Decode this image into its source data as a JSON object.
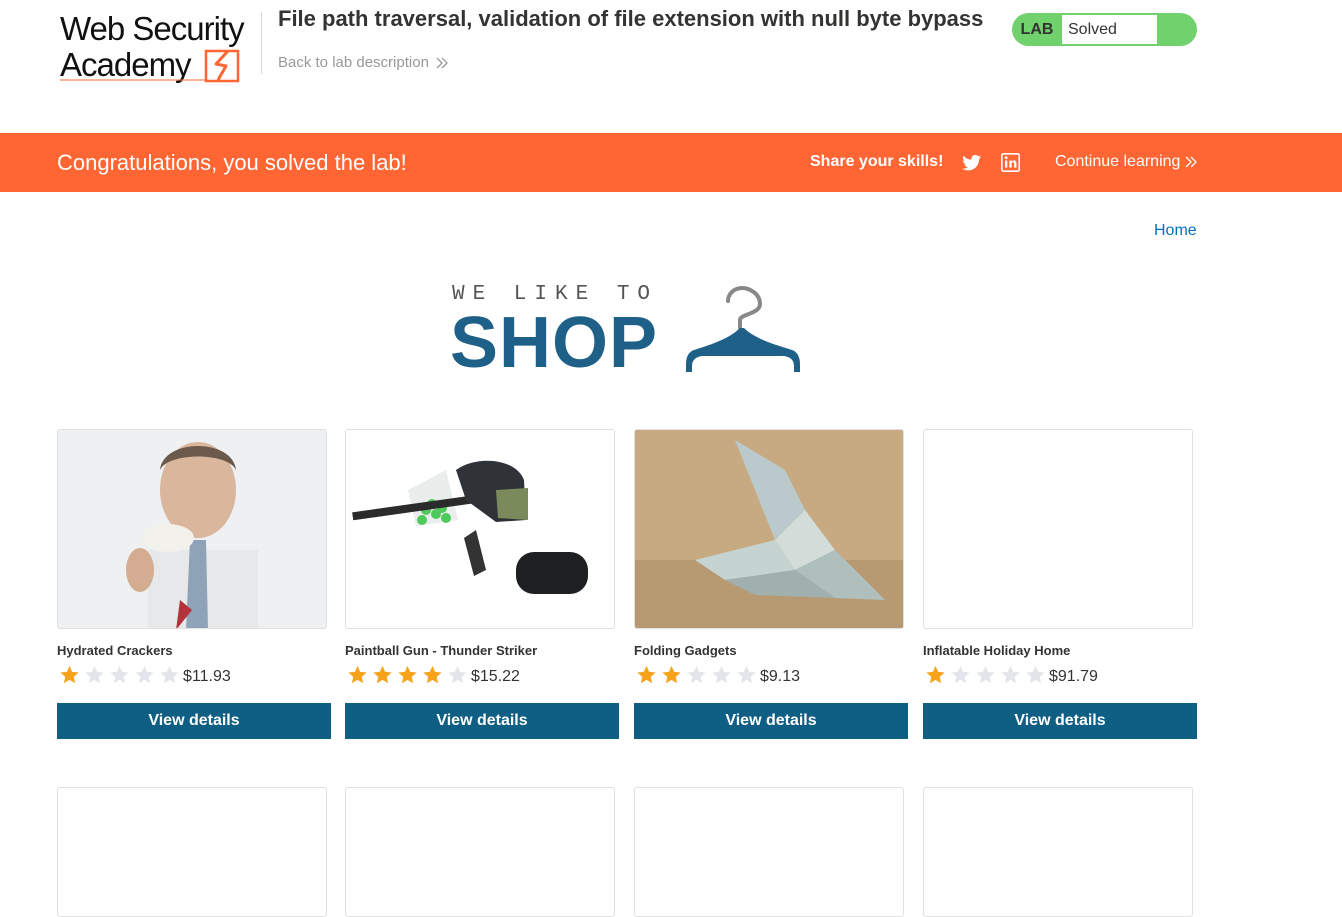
{
  "header": {
    "logo_line1": "Web Security",
    "logo_line2": "Academy",
    "title": "File path traversal, validation of file extension with null byte bypass",
    "back_link": "Back to lab description",
    "lab_label": "LAB",
    "lab_status": "Solved"
  },
  "banner": {
    "message": "Congratulations, you solved the lab!",
    "share_label": "Share your skills!",
    "continue_label": "Continue learning"
  },
  "nav": {
    "home": "Home"
  },
  "shop": {
    "tagline": "WE LIKE TO",
    "word": "SHOP"
  },
  "products": [
    {
      "name": "Hydrated Crackers",
      "rating": 1,
      "price": "$11.93",
      "button": "View details"
    },
    {
      "name": "Paintball Gun - Thunder Striker",
      "rating": 4,
      "price": "$15.22",
      "button": "View details"
    },
    {
      "name": "Folding Gadgets",
      "rating": 2,
      "price": "$9.13",
      "button": "View details"
    },
    {
      "name": "Inflatable Holiday Home",
      "rating": 1,
      "price": "$91.79",
      "button": "View details"
    }
  ],
  "colors": {
    "brand_orange": "#ff6633",
    "button_blue": "#0f5f85",
    "status_green": "#70d16d",
    "link_blue": "#0071bc",
    "star_filled": "#f7a21b",
    "star_empty": "#e2e6ea"
  }
}
